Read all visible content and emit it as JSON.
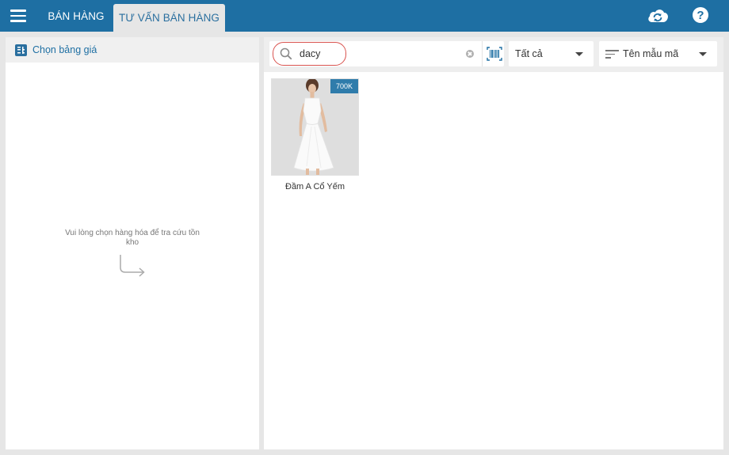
{
  "topbar": {
    "tabs": [
      {
        "label": "BÁN HÀNG",
        "active": false
      },
      {
        "label": "TƯ VẤN BÁN HÀNG",
        "active": true
      }
    ],
    "help_label": "?"
  },
  "left_panel": {
    "header_label": "Chọn bảng giá",
    "empty_hint": "Vui lòng chọn hàng hóa để tra cứu tồn kho"
  },
  "search": {
    "value": "dacy",
    "category_filter": "Tất cả",
    "sort_by": "Tên mẫu mã"
  },
  "products": [
    {
      "name": "Đầm A Cổ Yếm",
      "price_badge": "700K"
    }
  ],
  "colors": {
    "topbar": "#1e6fa3",
    "accent": "#2a6f9f",
    "badge": "#2f7cab",
    "highlight": "#d9534f"
  }
}
